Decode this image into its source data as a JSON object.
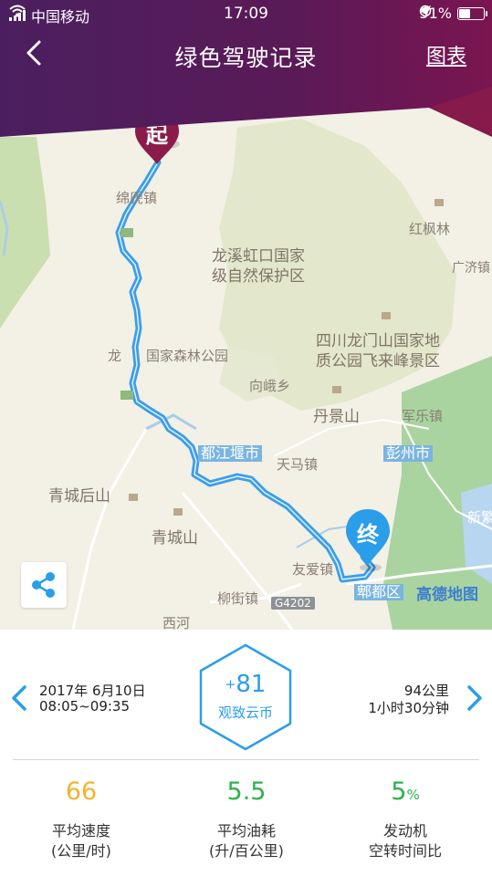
{
  "status_bar": {
    "carrier": "中国移动",
    "time": "17:09",
    "battery_percent": "51%",
    "battery_level": 0.51
  },
  "nav": {
    "title": "绿色驾驶记录",
    "chart_link": "图表"
  },
  "map": {
    "start_marker": "起",
    "end_marker": "终",
    "attribution": "高德地图",
    "labels": {
      "hongfenglin": "红枫林",
      "guangji": "广济镇",
      "reserve_1": "龙溪虹口国家",
      "reserve_2": "级自然保护区",
      "longmen_1": "四川龙门山国家地",
      "longmen_2": "质公园飞来峰景区",
      "forest_park": "龙",
      "forest_park_rest": "国家森林公园",
      "xiange": "向峨乡",
      "danjingshan": "丹景山",
      "junle": "军乐镇",
      "dujiangyan": "都江堰市",
      "tianma": "天马镇",
      "pengzhou": "彭州市",
      "qingcheng_back": "青城后山",
      "qingchengshan": "青城山",
      "youai": "友爱镇",
      "pixian": "郫都区",
      "liujie": "柳街镇",
      "road_g4202": "G4202",
      "xuankou": "绵虒镇",
      "xinfan": "新繁",
      "xihe": "西河"
    },
    "colors": {
      "route": "#3b9ee8",
      "start_marker": "#8a1b4a",
      "end_marker": "#2a9ee8"
    }
  },
  "trip": {
    "date": "2017年 6月10日",
    "time_range": "08:05~09:35",
    "distance": "94公里",
    "duration": "1小时30分钟",
    "coins_sign": "+",
    "coins_value": "81",
    "coins_label": "观致云币"
  },
  "stats": [
    {
      "value": "66",
      "unit": "",
      "label_1": "平均速度",
      "label_2": "(公里/时)",
      "color": "#f4b32d"
    },
    {
      "value": "5.5",
      "unit": "",
      "label_1": "平均油耗",
      "label_2": "(升/百公里)",
      "color": "#2cb34a"
    },
    {
      "value": "5",
      "unit": "%",
      "label_1": "发动机",
      "label_2": "空转时间比",
      "color": "#2cb34a"
    }
  ]
}
